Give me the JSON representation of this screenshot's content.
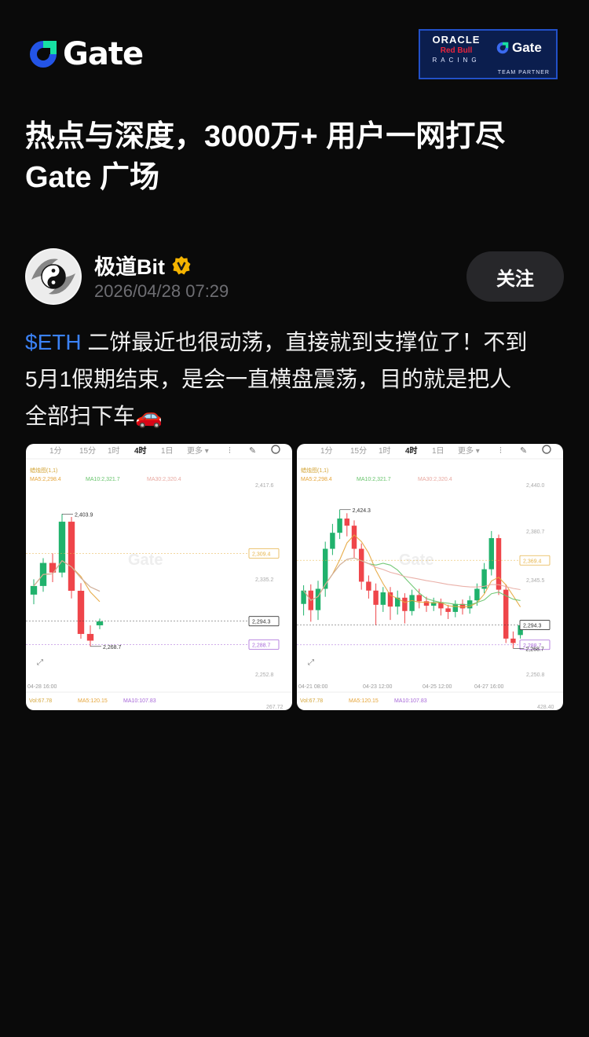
{
  "brand": {
    "name": "Gate",
    "accent": "#2354e6",
    "accent2": "#17e0a3"
  },
  "partner_badge": {
    "oracle": "ORACLE",
    "redbull": "Red Bull",
    "racing": "RACING",
    "gate": "Gate",
    "partner": "TEAM PARTNER"
  },
  "headline": {
    "line1": "热点与深度，3000万+ 用户一网打尽",
    "line2": "Gate 广场"
  },
  "post": {
    "author": "极道Bit",
    "verified": true,
    "time": "2026/04/28 07:29",
    "follow_label": "关注",
    "ticker": "$ETH",
    "body_line1": " 二饼最近也很动荡，直接就到支撑位了！不到",
    "body_line2": "5月1假期结束，是会一直横盘震荡，目的就是把人",
    "body_line3": "全部扫下车",
    "body_emoji": "🚗"
  },
  "chart_tabs": [
    "1分",
    "15分",
    "1时",
    "4时",
    "1日",
    "更多 ▾"
  ],
  "chart_data": [
    {
      "type": "candlestick",
      "interval": "4时",
      "indicator_label": "蜡烛图(1,1)",
      "ma_labels": [
        "MA5:2,298.4",
        "MA10:2,321.7",
        "MA30:2,320.4"
      ],
      "y_ticks": [
        "2,417.6",
        "2,335.2",
        "2,252.8"
      ],
      "price_tags": [
        "2,309.4",
        "2,294.3",
        "2,288.7"
      ],
      "high_label": "2,403.9",
      "low_label": "2,268.7",
      "x_label": "04-28 16:00",
      "vol_labels": [
        "Vol:67.78",
        "MA5:120.15",
        "MA10:107.83"
      ],
      "vol_max": "267.72",
      "candles": [
        {
          "o": 2322,
          "c": 2331,
          "h": 2338,
          "l": 2312
        },
        {
          "o": 2331,
          "c": 2355,
          "h": 2360,
          "l": 2325
        },
        {
          "o": 2355,
          "c": 2345,
          "h": 2365,
          "l": 2335
        },
        {
          "o": 2345,
          "c": 2398,
          "h": 2406,
          "l": 2340
        },
        {
          "o": 2398,
          "c": 2326,
          "h": 2403,
          "l": 2318
        },
        {
          "o": 2326,
          "c": 2281,
          "h": 2334,
          "l": 2276
        },
        {
          "o": 2281,
          "c": 2274,
          "h": 2290,
          "l": 2268
        },
        {
          "o": 2290,
          "c": 2294,
          "h": 2297,
          "l": 2286
        }
      ]
    },
    {
      "type": "candlestick",
      "interval": "4时",
      "indicator_label": "蜡烛图(1,1)",
      "ma_labels": [
        "MA5:2,298.4",
        "MA10:2,321.7",
        "MA30:2,320.4"
      ],
      "y_ticks": [
        "2,440.0",
        "2,380.7",
        "2,345.5",
        "2,250.8"
      ],
      "price_tags": [
        "2,369.4",
        "2,294.3",
        "2,288.7"
      ],
      "high_label": "2,424.3",
      "low_label": "2,268.7",
      "x_labels": [
        "04-21 08:00",
        "04-23 12:00",
        "04-25 12:00",
        "04-27 16:00"
      ],
      "vol_labels": [
        "Vol:67.78",
        "MA5:120.15",
        "MA10:107.83"
      ],
      "vol_max": "428.40",
      "candles": [
        {
          "o": 2318,
          "c": 2333,
          "h": 2339,
          "l": 2305
        },
        {
          "o": 2333,
          "c": 2311,
          "h": 2340,
          "l": 2298
        },
        {
          "o": 2311,
          "c": 2335,
          "h": 2344,
          "l": 2300
        },
        {
          "o": 2335,
          "c": 2380,
          "h": 2388,
          "l": 2326
        },
        {
          "o": 2380,
          "c": 2398,
          "h": 2408,
          "l": 2373
        },
        {
          "o": 2398,
          "c": 2414,
          "h": 2424,
          "l": 2391
        },
        {
          "o": 2414,
          "c": 2406,
          "h": 2420,
          "l": 2394
        },
        {
          "o": 2406,
          "c": 2380,
          "h": 2412,
          "l": 2370
        },
        {
          "o": 2380,
          "c": 2343,
          "h": 2386,
          "l": 2334
        },
        {
          "o": 2343,
          "c": 2333,
          "h": 2350,
          "l": 2324
        },
        {
          "o": 2333,
          "c": 2317,
          "h": 2341,
          "l": 2294
        },
        {
          "o": 2317,
          "c": 2331,
          "h": 2337,
          "l": 2309
        },
        {
          "o": 2331,
          "c": 2315,
          "h": 2337,
          "l": 2300
        },
        {
          "o": 2315,
          "c": 2325,
          "h": 2333,
          "l": 2306
        },
        {
          "o": 2325,
          "c": 2310,
          "h": 2330,
          "l": 2296
        },
        {
          "o": 2310,
          "c": 2328,
          "h": 2334,
          "l": 2305
        },
        {
          "o": 2328,
          "c": 2321,
          "h": 2335,
          "l": 2313
        },
        {
          "o": 2321,
          "c": 2316,
          "h": 2326,
          "l": 2309
        },
        {
          "o": 2316,
          "c": 2320,
          "h": 2325,
          "l": 2310
        },
        {
          "o": 2320,
          "c": 2313,
          "h": 2324,
          "l": 2305
        },
        {
          "o": 2313,
          "c": 2309,
          "h": 2317,
          "l": 2301
        },
        {
          "o": 2309,
          "c": 2318,
          "h": 2322,
          "l": 2303
        },
        {
          "o": 2318,
          "c": 2313,
          "h": 2323,
          "l": 2306
        },
        {
          "o": 2313,
          "c": 2322,
          "h": 2327,
          "l": 2307
        },
        {
          "o": 2322,
          "c": 2335,
          "h": 2341,
          "l": 2316
        },
        {
          "o": 2335,
          "c": 2357,
          "h": 2364,
          "l": 2330
        },
        {
          "o": 2357,
          "c": 2392,
          "h": 2400,
          "l": 2350
        },
        {
          "o": 2392,
          "c": 2334,
          "h": 2396,
          "l": 2328
        },
        {
          "o": 2334,
          "c": 2279,
          "h": 2340,
          "l": 2274
        },
        {
          "o": 2279,
          "c": 2274,
          "h": 2287,
          "l": 2268
        },
        {
          "o": 2283,
          "c": 2294,
          "h": 2299,
          "l": 2279
        }
      ]
    }
  ]
}
